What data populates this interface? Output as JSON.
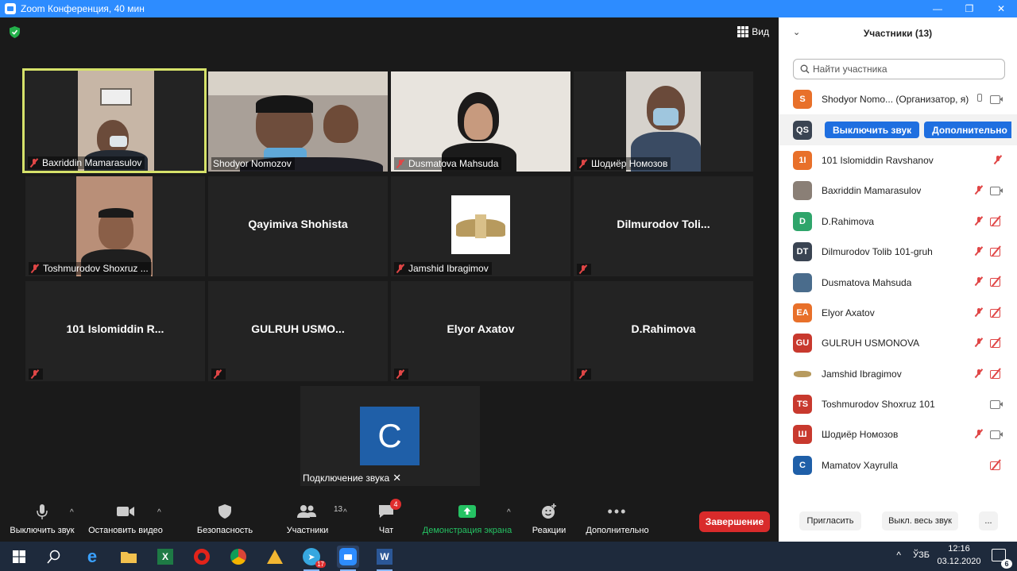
{
  "window": {
    "title": "Zoom Конференция, 40 мин",
    "minimize": "—",
    "maximize": "❐",
    "close": "✕"
  },
  "meeting": {
    "view_label": "Вид",
    "tiles": [
      {
        "name": "Baxriddin Mamarasulov",
        "type": "video"
      },
      {
        "name": "Shodyor Nomozov",
        "type": "video"
      },
      {
        "name": "Dusmatova Mahsuda",
        "type": "video"
      },
      {
        "name": "Шодиёр Номозов",
        "type": "video"
      },
      {
        "name": "Toshmurodov Shoxruz ...",
        "type": "video"
      },
      {
        "name": "Qayimiva Shohista",
        "type": "name"
      },
      {
        "name": "Jamshid Ibragimov",
        "type": "image"
      },
      {
        "name": "Dilmurodov  Toli...",
        "type": "name"
      },
      {
        "name": "101  Islomiddin  R...",
        "type": "name"
      },
      {
        "name": "GULRUH  USMO...",
        "type": "name"
      },
      {
        "name": "Elyor Axatov",
        "type": "name"
      },
      {
        "name": "D.Rahimova",
        "type": "name"
      }
    ],
    "audio_tile": {
      "avatar_letter": "C",
      "label": "Подключение звука"
    }
  },
  "toolbar": {
    "mute": "Выключить звук",
    "stop_video": "Остановить видео",
    "security": "Безопасность",
    "participants": "Участники",
    "participants_count": "13",
    "chat": "Чат",
    "chat_badge": "4",
    "share": "Демонстрация экрана",
    "reactions": "Реакции",
    "more": "Дополнительно",
    "end": "Завершение"
  },
  "panel": {
    "title": "Участники (13)",
    "search_placeholder": "Найти участника",
    "participants": [
      {
        "initials": "S",
        "name": "Shodyor Nomo... (Организатор, я)",
        "color": "#e8702a"
      },
      {
        "initials": "QS",
        "name": "",
        "color": "#3a4452"
      },
      {
        "initials": "1I",
        "name": "101 Islomiddin Ravshanov",
        "color": "#e8702a"
      },
      {
        "initials": "",
        "name": "Baxriddin Mamarasulov",
        "color": "#8a7f76"
      },
      {
        "initials": "D",
        "name": "D.Rahimova",
        "color": "#2fa56b"
      },
      {
        "initials": "DT",
        "name": "Dilmurodov Tolib 101-gruh",
        "color": "#3a4452"
      },
      {
        "initials": "",
        "name": "Dusmatova Mahsuda",
        "color": "#4a6c8c"
      },
      {
        "initials": "EA",
        "name": "Elyor Axatov",
        "color": "#e8702a"
      },
      {
        "initials": "GU",
        "name": "GULRUH USMONOVA",
        "color": "#c8392e"
      },
      {
        "initials": "",
        "name": "Jamshid Ibragimov",
        "color": "#b79a5e"
      },
      {
        "initials": "TS",
        "name": "Toshmurodov Shoxruz 101",
        "color": "#c8392e"
      },
      {
        "initials": "Ш",
        "name": "Шодиёр Номозов",
        "color": "#c8392e"
      },
      {
        "initials": "C",
        "name": "Mamatov Xayrulla",
        "color": "#1f5fa8"
      }
    ],
    "qs_mute_button": "Выключить звук",
    "qs_more_button": "Дополнительно",
    "invite": "Пригласить",
    "mute_all": "Выкл. весь звук",
    "more_dots": "..."
  },
  "taskbar": {
    "lang": "ЎЗБ",
    "time": "12:16",
    "date": "03.12.2020",
    "notif_count": "6",
    "telegram_badge": "17"
  }
}
